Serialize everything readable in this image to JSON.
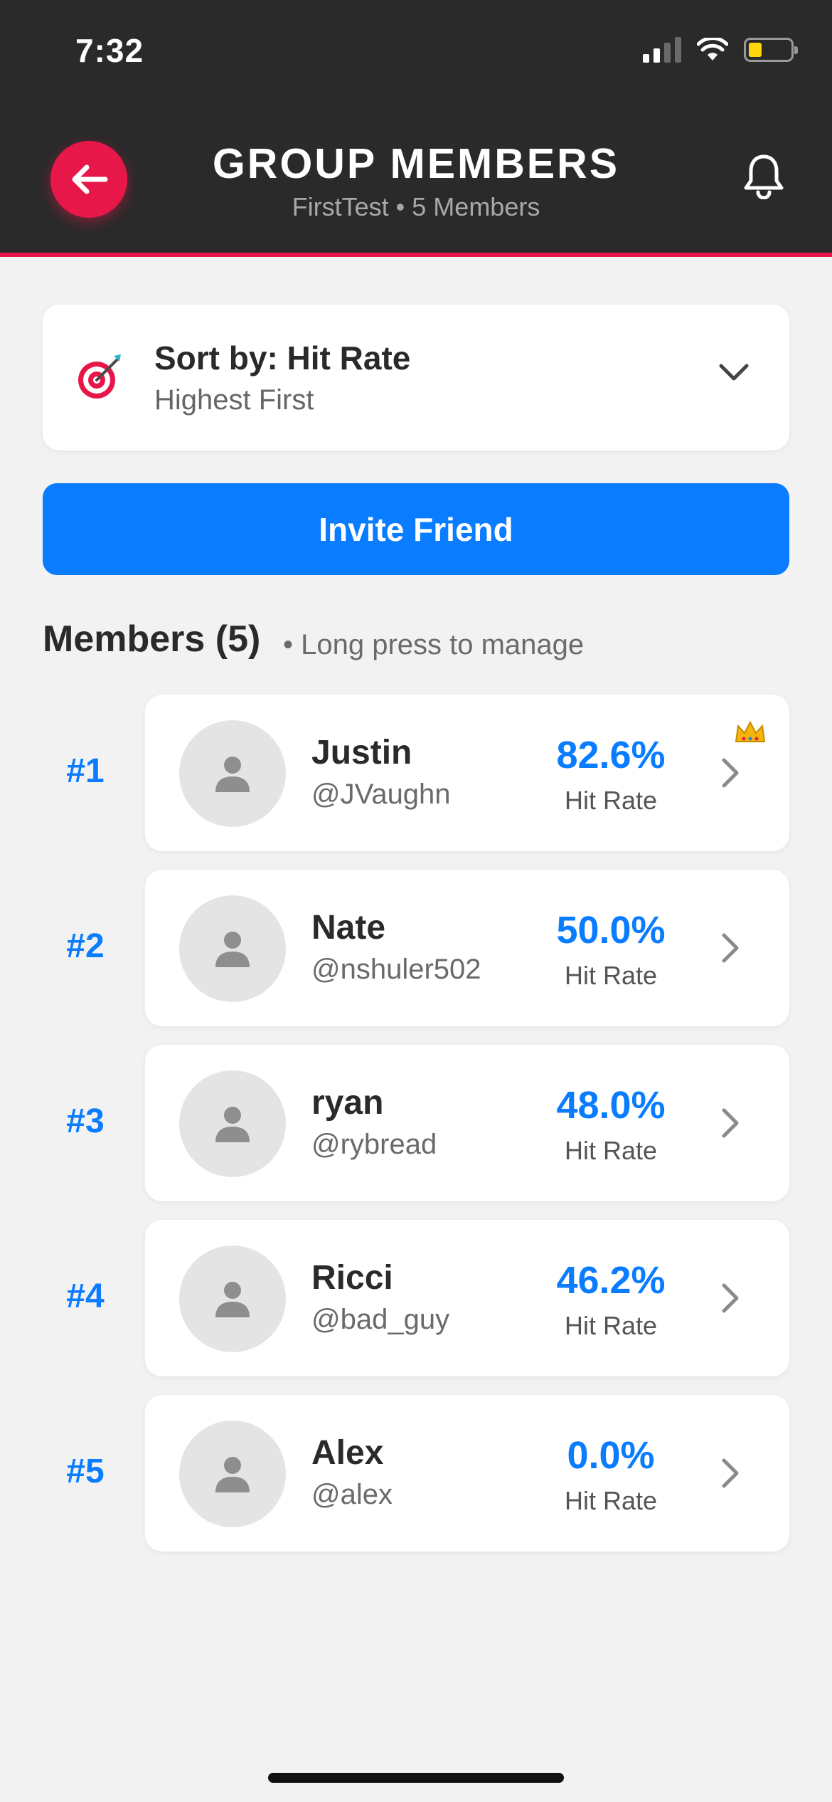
{
  "status_bar": {
    "time": "7:32"
  },
  "header": {
    "title": "GROUP MEMBERS",
    "group_name": "FirstTest",
    "member_count": "5 Members",
    "separator": "•"
  },
  "sort": {
    "label": "Sort by: Hit Rate",
    "order": "Highest First",
    "icon": "target-dart-icon"
  },
  "invite_button": {
    "label": "Invite Friend"
  },
  "members_section": {
    "title": "Members (5)",
    "hint": "• Long press to manage"
  },
  "members": [
    {
      "rank": "#1",
      "name": "Justin",
      "handle": "@JVaughn",
      "hit_rate": "82.6%",
      "hit_rate_label": "Hit Rate",
      "crown": true
    },
    {
      "rank": "#2",
      "name": "Nate",
      "handle": "@nshuler502",
      "hit_rate": "50.0%",
      "hit_rate_label": "Hit Rate",
      "crown": false
    },
    {
      "rank": "#3",
      "name": "ryan",
      "handle": "@rybread",
      "hit_rate": "48.0%",
      "hit_rate_label": "Hit Rate",
      "crown": false
    },
    {
      "rank": "#4",
      "name": "Ricci",
      "handle": "@bad_guy",
      "hit_rate": "46.2%",
      "hit_rate_label": "Hit Rate",
      "crown": false
    },
    {
      "rank": "#5",
      "name": "Alex",
      "handle": "@alex",
      "hit_rate": "0.0%",
      "hit_rate_label": "Hit Rate",
      "crown": false
    }
  ],
  "colors": {
    "header_bg": "#2a2a2a",
    "accent_red": "#e8174a",
    "accent_blue": "#0a7cff",
    "page_bg": "#f2f2f2"
  }
}
